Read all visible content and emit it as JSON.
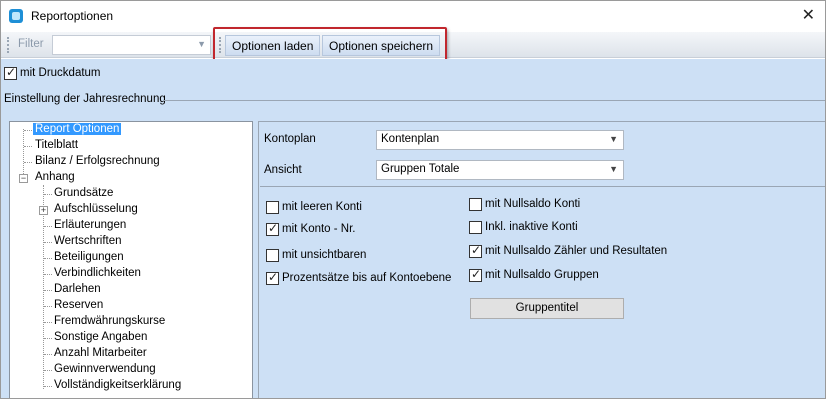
{
  "window": {
    "title": "Reportoptionen",
    "close": "✕"
  },
  "toolbar": {
    "filter_label": "Filter",
    "filter_value": "",
    "load_label": "Optionen laden",
    "save_label": "Optionen speichern"
  },
  "options": {
    "print_date_label": "mit Druckdatum",
    "print_date_checked": true
  },
  "group": {
    "title": "Einstellung der Jahresrechnung"
  },
  "tree": {
    "items": [
      "Report Optionen",
      "Titelblatt",
      "Bilanz / Erfolgsrechnung",
      "Anhang",
      "Grundsätze",
      "Aufschlüsselung",
      "Erläuterungen",
      "Wertschriften",
      "Beteiligungen",
      "Verbindlichkeiten",
      "Darlehen",
      "Reserven",
      "Fremdwährungskurse",
      "Sonstige Angaben",
      "Anzahl Mitarbeiter",
      "Gewinnverwendung",
      "Vollständigkeitserklärung"
    ],
    "expander_minus": "−",
    "expander_plus": "+"
  },
  "panel": {
    "kontoplan_label": "Kontoplan",
    "kontoplan_value": "Kontenplan",
    "ansicht_label": "Ansicht",
    "ansicht_value": "Gruppen Totale",
    "checkboxes": [
      {
        "label": "mit leeren Konti",
        "checked": false
      },
      {
        "label": "mit Konto - Nr.",
        "checked": true
      },
      {
        "label": "mit unsichtbaren",
        "checked": false
      },
      {
        "label": "Prozentsätze bis auf Kontoebene",
        "checked": true
      },
      {
        "label": "mit Nullsaldo Konti",
        "checked": false
      },
      {
        "label": "Inkl. inaktive Konti",
        "checked": false
      },
      {
        "label": "mit Nullsaldo Zähler und Resultaten",
        "checked": true
      },
      {
        "label": "mit Nullsaldo Gruppen",
        "checked": true
      }
    ],
    "group_title_button": "Gruppentitel"
  },
  "icons": {
    "app": "report-app-icon",
    "dropdown": "chevron-down-icon"
  }
}
